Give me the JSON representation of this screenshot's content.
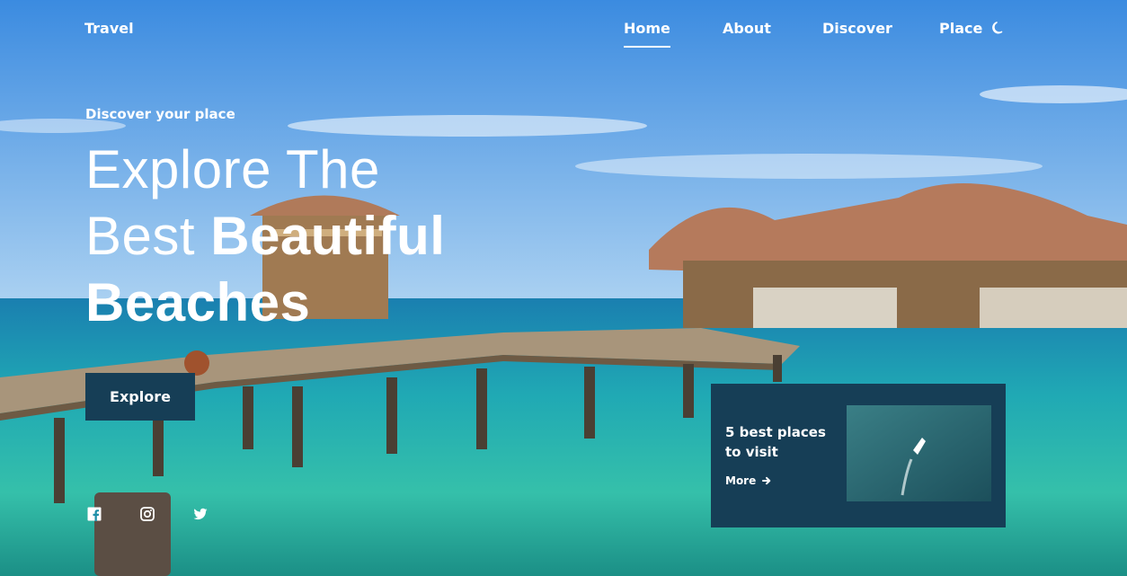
{
  "nav": {
    "logo": "Travel",
    "links": [
      {
        "label": "Home",
        "active": true
      },
      {
        "label": "About",
        "active": false
      },
      {
        "label": "Discover",
        "active": false
      },
      {
        "label": "Place",
        "active": false
      }
    ],
    "theme_toggle_icon": "moon-icon"
  },
  "hero": {
    "eyebrow": "Discover your place",
    "headline_line1": "Explore The",
    "headline_line2_regular": "Best ",
    "headline_line2_bold": "Beautiful",
    "headline_line3_bold": "Beaches",
    "cta_label": "Explore",
    "background_image": "overwater-bungalows-beach-photo"
  },
  "social": {
    "icons": [
      "facebook-icon",
      "instagram-icon",
      "twitter-icon"
    ]
  },
  "card": {
    "title": "5 best places to visit",
    "more_label": "More",
    "more_icon": "arrow-right-icon",
    "image": "aerial-boat-on-sea-photo"
  },
  "colors": {
    "accent": "#163e56",
    "text": "#ffffff"
  }
}
